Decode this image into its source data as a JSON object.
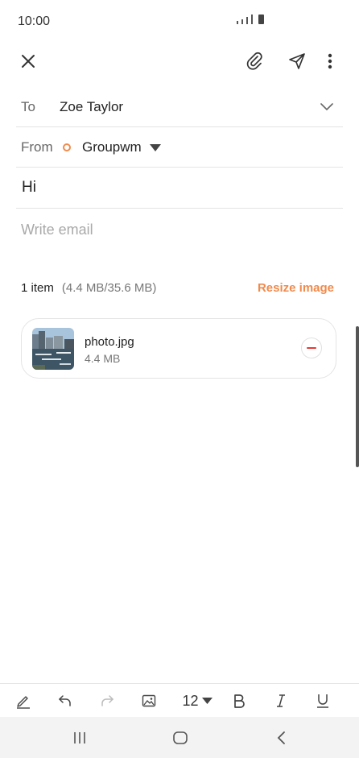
{
  "status_bar": {
    "time": "10:00"
  },
  "compose": {
    "to_label": "To",
    "to_value": "Zoe Taylor",
    "from_label": "From",
    "from_value": "Groupwm",
    "subject": "Hi",
    "body_placeholder": "Write email"
  },
  "attachments": {
    "count_text": "1 item",
    "size_text": "(4.4 MB/35.6 MB)",
    "resize_label": "Resize image",
    "items": [
      {
        "name": "photo.jpg",
        "size": "4.4 MB"
      }
    ]
  },
  "format_toolbar": {
    "font_size": "12"
  },
  "colors": {
    "accent": "#f08a4b",
    "remove": "#e53935"
  }
}
